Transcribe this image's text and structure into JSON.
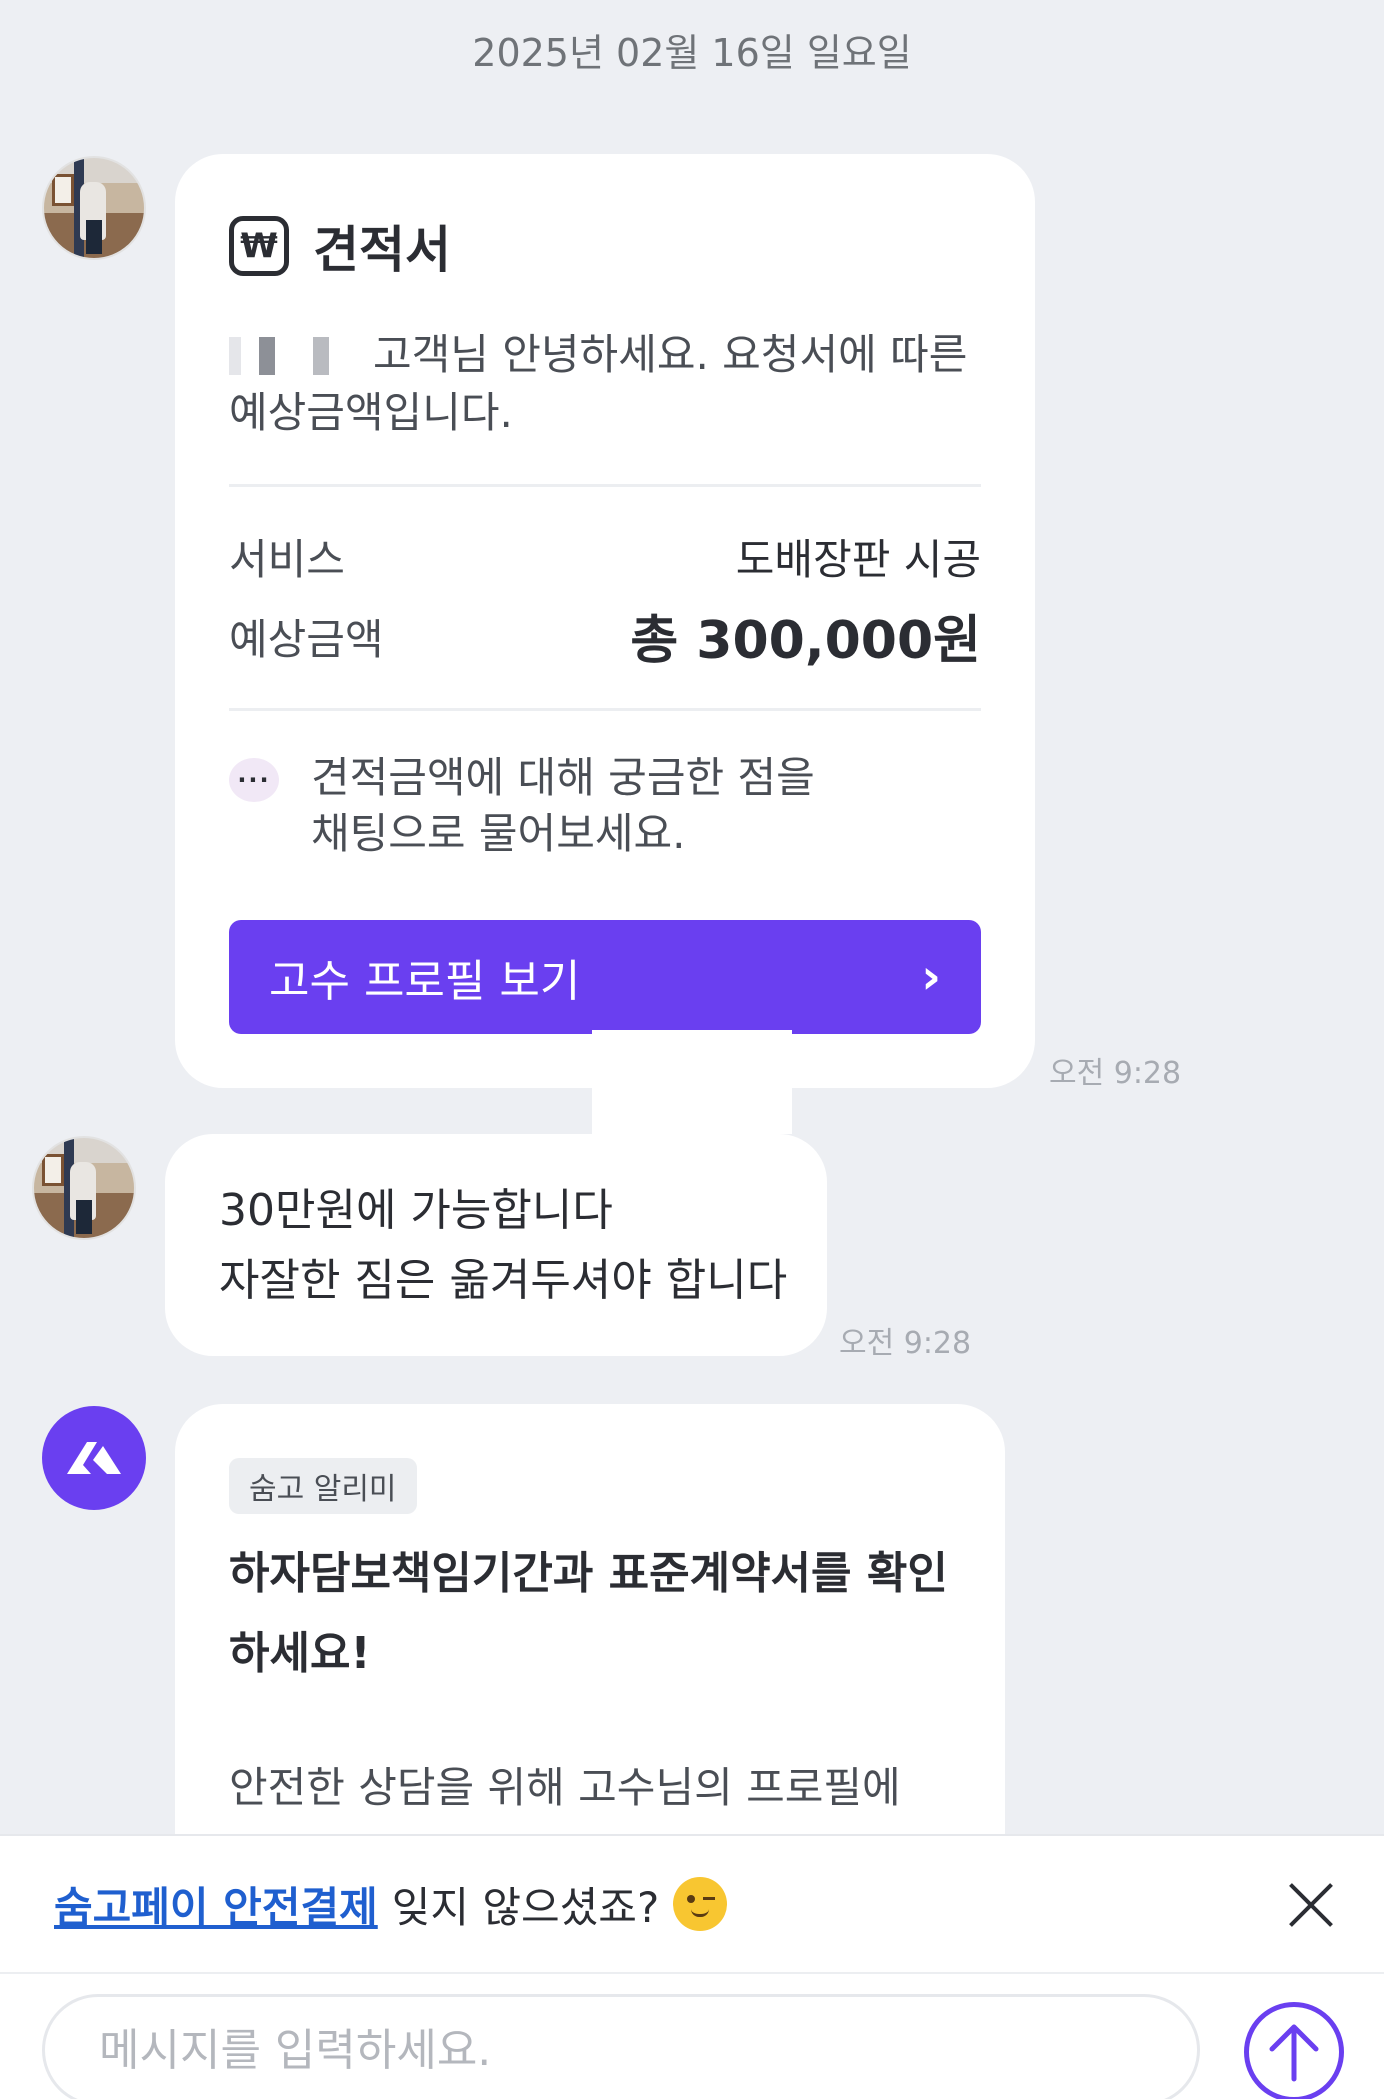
{
  "date_header": "2025년 02월 16일 일요일",
  "quote": {
    "title": "견적서",
    "intro_suffix": "고객님 안녕하세요. 요청서에 따른",
    "intro_line2": "예상금액입니다.",
    "service_label": "서비스",
    "service_value": "도배장판 시공",
    "price_label": "예상금액",
    "price_value": "총 300,000원",
    "question_line1": "견적금액에 대해 궁금한 점을",
    "question_line2": "채팅으로 물어보세요.",
    "profile_button_label": "고수 프로필 보기",
    "time": "오전 9:28"
  },
  "message": {
    "line1": "30만원에 가능합니다",
    "line2": "자잘한 짐은 옮겨두셔야 합니다",
    "time": "오전 9:28"
  },
  "notice": {
    "tag": "숨고 알리미",
    "title_line1": "하자담보책임기간과 표준계약서를 확인",
    "title_line2": "하세요!",
    "body": "안전한 상담을 위해 고수님의 프로필에"
  },
  "banner": {
    "link": "숨고페이 안전결제",
    "text": "잊지 않으셨죠?"
  },
  "composer": {
    "placeholder": "메시지를 입력하세요."
  },
  "colors": {
    "accent": "#6a3ff0",
    "background": "#edeff3",
    "link": "#1f5fcf"
  },
  "icons": [
    "won-icon",
    "speech-bubble-icon",
    "chevron-right-icon",
    "soomgo-logo-icon",
    "wink-emoji-icon",
    "close-icon",
    "arrow-up-icon"
  ]
}
